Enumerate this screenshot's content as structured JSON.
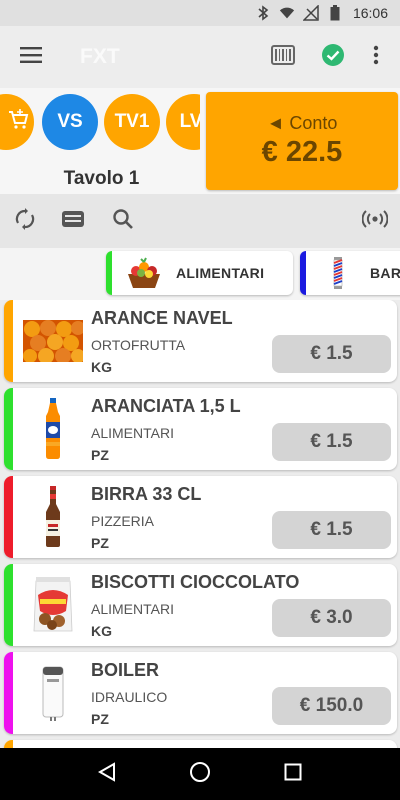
{
  "status_bar": {
    "time": "16:06",
    "icons": [
      "bluetooth-icon",
      "wifi-icon",
      "no-signal-icon",
      "battery-icon"
    ]
  },
  "app_bar": {
    "title": "FXT",
    "actions": [
      "barcode-icon",
      "check-circle-icon",
      "more-vert-icon"
    ],
    "check_color": "#2eb872"
  },
  "tables": {
    "chips": [
      {
        "label": "",
        "color": "#ffa500"
      },
      {
        "label": "VS",
        "color": "#1e88e5"
      },
      {
        "label": "TV1",
        "color": "#ffa500"
      },
      {
        "label": "LV",
        "color": "#ffa500"
      }
    ],
    "current": "Tavolo 1"
  },
  "conto": {
    "label": "◄ Conto",
    "amount": "€ 22.5",
    "color": "#ffa500"
  },
  "toolbar": {
    "icons": [
      "sync-icon",
      "keyboard-icon",
      "search-icon",
      "wireless-icon"
    ]
  },
  "categories": [
    {
      "label": "ALIMENTARI",
      "color": "#2ee02e",
      "icon": "fruit-basket-icon"
    },
    {
      "label": "BAR",
      "color": "#1a1ae0",
      "icon": "barber-pole-icon"
    }
  ],
  "products": [
    {
      "name": "ARANCE NAVEL",
      "category": "ORTOFRUTTA",
      "unit": "KG",
      "price": "€ 1.5",
      "color": "#ffa500",
      "icon": "oranges-icon"
    },
    {
      "name": "ARANCIATA 1,5 L",
      "category": "ALIMENTARI",
      "unit": "PZ",
      "price": "€ 1.5",
      "color": "#2ee02e",
      "icon": "orange-soda-bottle-icon"
    },
    {
      "name": "BIRRA 33 CL",
      "category": "PIZZERIA",
      "unit": "PZ",
      "price": "€ 1.5",
      "color": "#ee1c2b",
      "icon": "beer-bottle-icon"
    },
    {
      "name": "BISCOTTI CIOCCOLATO",
      "category": "ALIMENTARI",
      "unit": "KG",
      "price": "€ 3.0",
      "color": "#2ee02e",
      "icon": "cookies-bag-icon"
    },
    {
      "name": "BOILER",
      "category": "IDRAULICO",
      "unit": "PZ",
      "price": "€ 150.0",
      "color": "#ee11ee",
      "icon": "water-heater-icon"
    }
  ]
}
